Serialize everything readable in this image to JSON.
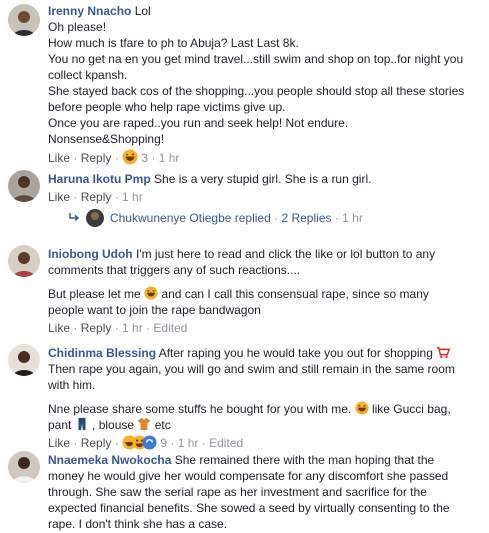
{
  "comments": [
    {
      "author": "Irenny Nnacho",
      "lines": [
        " Lol",
        "Oh please!",
        "How much is tfare to ph to Abuja? Last Last 8k.",
        "You no get na en you get mind travel...still swim and shop on top..for night you",
        "collect kpansh.",
        "She stayed back cos of the shopping...you people should stop all these stories",
        "before people who help rape victims give up.",
        "Once you are raped..you run and seek help! Not endure.",
        "Nonsense&Shopping!"
      ],
      "like": "Like",
      "reply": "Reply",
      "reactions": "3",
      "time": "1 hr"
    },
    {
      "author": "Haruna Ikotu Pmp",
      "text": " She is a very stupid girl. She is a run girl.",
      "like": "Like",
      "reply": "Reply",
      "time": "1 hr",
      "replies": {
        "author": "Chukwunenye Otiegbe",
        "action": " replied",
        "count": "2 Replies",
        "time": "1 hr"
      }
    },
    {
      "author": "Iniobong Udoh",
      "line1": " I'm just here to read and click the like or lol button to any",
      "line2": "comments that triggers any of such reactions....",
      "line3a": "But please let me ",
      "line3b": " and can I call this consensual rape, since so many",
      "line4": "people want to join the rape bandwagon",
      "like": "Like",
      "reply": "Reply",
      "time": "1 hr",
      "edited": "Edited"
    },
    {
      "author": "Chidinma Blessing",
      "line1": " After raping you he would take you out for shopping ",
      "line2": "Then rape you again, you will go and swim and still remain in the same room",
      "line3": "with him.",
      "line4a": "Nne please share some stuffs he bought for you with me. ",
      "line4b": " like Gucci bag,",
      "line5a": "pant ",
      "line5b": " , blouse ",
      "line5c": " etc",
      "like": "Like",
      "reply": "Reply",
      "reactions": "9",
      "time": "1 hr",
      "edited": "Edited"
    },
    {
      "author": "Nnaemeka Nwokocha",
      "lines": [
        " She remained there with the man hoping that the",
        "money he would give her would compensate for any discomfort she passed",
        "through. She saw the serial rape as her investment and sacrifice for the",
        "expected financial benefits. She sowed a seed by virtually consenting to the",
        "rape. I don't think she has a case."
      ]
    }
  ],
  "meta_sep": " · ",
  "colors": {
    "link": "#385898",
    "meta": "#90949c",
    "text": "#1d2129"
  },
  "icons": [
    "haha-emoji",
    "shopping-cart-emoji",
    "jeans-emoji",
    "shirt-emoji",
    "love-reaction",
    "haha-reaction",
    "reply-arrow-icon"
  ]
}
